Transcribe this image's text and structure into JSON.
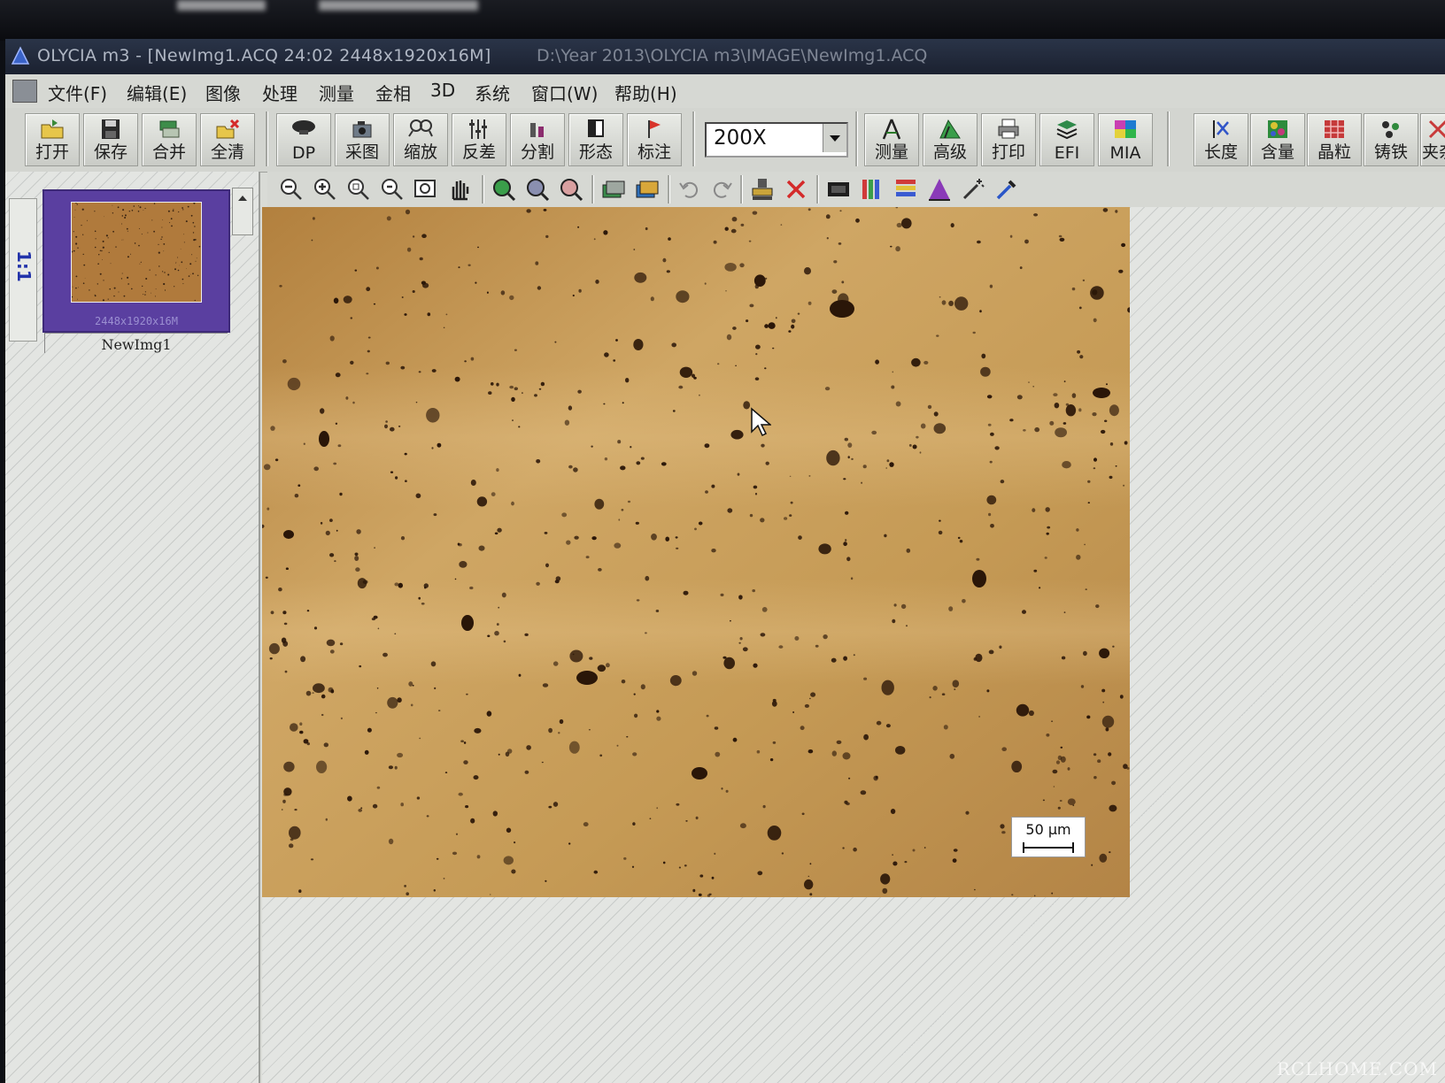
{
  "window": {
    "title": "OLYCIA m3 - [NewImg1.ACQ 24:02  2448x1920x16M]",
    "path": "D:\\Year 2013\\OLYCIA m3\\IMAGE\\NewImg1.ACQ"
  },
  "menu": {
    "items": [
      "文件(F)",
      "编辑(E)",
      "图像",
      "处理",
      "测量",
      "金相",
      "3D",
      "系统",
      "窗口(W)",
      "帮助(H)"
    ]
  },
  "toolbar": {
    "buttons": [
      {
        "label": "打开",
        "icon": "folder-open-icon"
      },
      {
        "label": "保存",
        "icon": "floppy-disk-icon"
      },
      {
        "label": "合并",
        "icon": "stack-merge-icon"
      },
      {
        "label": "全清",
        "icon": "folder-clear-icon"
      },
      {
        "label": "DP",
        "icon": "camera-dp-icon"
      },
      {
        "label": "采图",
        "icon": "capture-icon"
      },
      {
        "label": "缩放",
        "icon": "zoom-icon"
      },
      {
        "label": "反差",
        "icon": "contrast-icon"
      },
      {
        "label": "分割",
        "icon": "segment-icon"
      },
      {
        "label": "形态",
        "icon": "morphology-icon"
      },
      {
        "label": "标注",
        "icon": "flag-annotate-icon"
      }
    ],
    "zoom_value": "200X",
    "buttons_right": [
      {
        "label": "测量",
        "icon": "measure-compass-icon"
      },
      {
        "label": "高级",
        "icon": "advanced-triangle-icon"
      },
      {
        "label": "打印",
        "icon": "printer-icon"
      },
      {
        "label": "EFI",
        "icon": "efi-layers-icon"
      },
      {
        "label": "MIA",
        "icon": "mia-image-icon"
      }
    ],
    "buttons_far": [
      {
        "label": "长度",
        "icon": "length-icon"
      },
      {
        "label": "含量",
        "icon": "content-icon"
      },
      {
        "label": "晶粒",
        "icon": "grain-icon"
      },
      {
        "label": "铸铁",
        "icon": "cast-iron-icon"
      },
      {
        "label": "夹杂",
        "icon": "inclusion-icon"
      }
    ]
  },
  "toolbar2": {
    "icons": [
      "zoom-out-icon",
      "zoom-in-icon",
      "zoom-fit-icon",
      "zoom-actual-icon",
      "zoom-window-icon",
      "pan-hand-icon",
      "zoom-region-icon",
      "zoom-select-icon",
      "zoom-reset-icon",
      "stack-icon",
      "stack-color-icon",
      "undo-icon",
      "redo-icon",
      "stamp-icon",
      "delete-x-icon",
      "film-icon",
      "color-bars-icon",
      "color-bars-alt-icon",
      "histogram-icon",
      "magic-wand-icon",
      "pipette-icon"
    ]
  },
  "left_panel": {
    "zoom_tab": "1:1",
    "thumbnail_caption": "2448x1920x16M",
    "thumbnail_name": "NewImg1"
  },
  "image": {
    "scale_label": "50 μm"
  },
  "watermark": "RCLHOME.COM",
  "colors": {
    "micrograph_base": "#c8a05a",
    "thumb_frame": "#5a3fa0",
    "titlebar": "#1b2130"
  }
}
